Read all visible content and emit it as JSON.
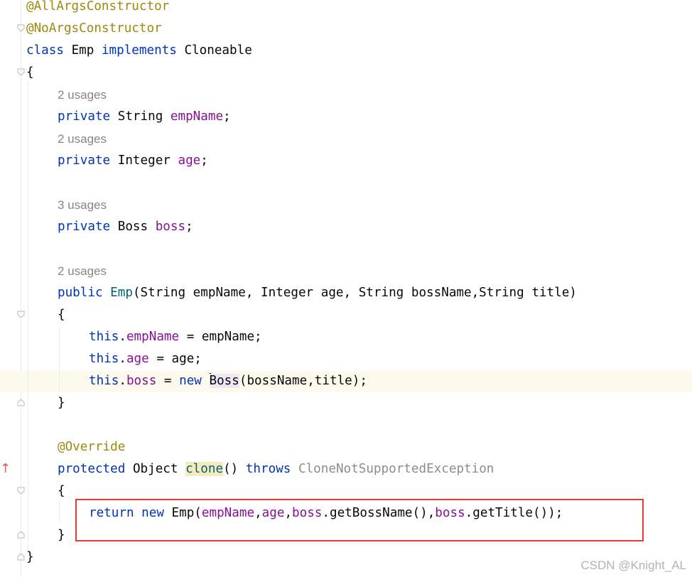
{
  "code": {
    "ann_all_args": "@AllArgsConstructor",
    "ann_no_args": "@NoArgsConstructor",
    "class_kw": "class",
    "class_name": "Emp",
    "implements_kw": "implements",
    "interface_name": "Cloneable",
    "open_brace": "{",
    "close_brace": "}",
    "hint_empname": "2 usages",
    "hint_age": "2 usages",
    "hint_boss": "3 usages",
    "hint_ctor": "2 usages",
    "private_kw": "private",
    "public_kw": "public",
    "type_string": "String",
    "type_integer": "Integer",
    "type_boss": "Boss",
    "field_empname": "empName",
    "field_age": "age",
    "field_boss": "boss",
    "semicolon": ";",
    "ctor_name": "Emp",
    "ctor_params": "(String empName, Integer age, String bossName,String title)",
    "this_kw": "this",
    "dot": ".",
    "assign_empname": " = empName;",
    "assign_age": " = age;",
    "assign_eq": " = ",
    "new_kw": "new",
    "boss_ctor_first": "B",
    "boss_ctor_rest": "oss",
    "boss_ctor_args": "(bossName,title);",
    "override_ann": "@Override",
    "protected_kw": "protected",
    "type_object": "Object",
    "clone_name": "clone",
    "parens": "()",
    "throws_kw": "throws",
    "exception_name": "CloneNotSupportedException",
    "return_kw": "return",
    "emp_call_open": "Emp(",
    "comma": ",",
    "get_boss_name": ".getBossName()",
    "get_title": ".getTitle());"
  },
  "watermark": "CSDN @Knight_AL"
}
